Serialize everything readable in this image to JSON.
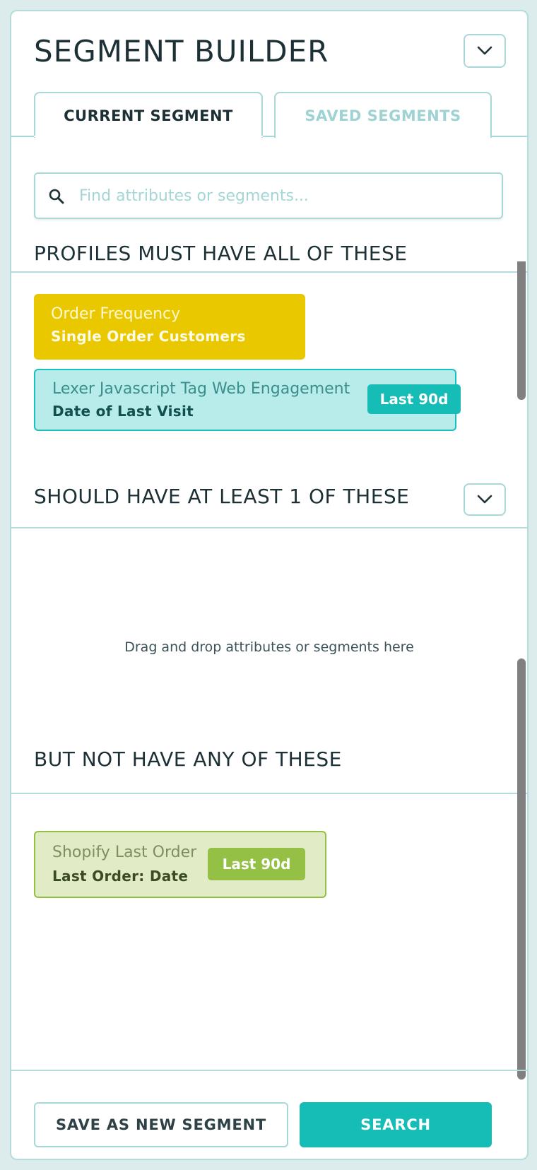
{
  "header": {
    "title": "SEGMENT BUILDER"
  },
  "tabs": [
    {
      "label": "CURRENT SEGMENT",
      "active": true
    },
    {
      "label": "SAVED SEGMENTS",
      "active": false
    }
  ],
  "search": {
    "placeholder": "Find attributes or segments...",
    "value": ""
  },
  "sections": {
    "must": {
      "title": "PROFILES MUST HAVE ALL OF THESE",
      "items": [
        {
          "name": "Order Frequency",
          "attribute": "Single Order Customers",
          "color": "#e9c800"
        },
        {
          "name": "Lexer Javascript Tag Web Engagement",
          "attribute": "Date of Last Visit",
          "badge": "Last 90d",
          "color": "#b7ecea"
        }
      ]
    },
    "should": {
      "title": "SHOULD HAVE AT LEAST 1 OF THESE",
      "empty_text": "Drag and drop attributes or segments here"
    },
    "not": {
      "title": "BUT NOT HAVE ANY OF THESE",
      "items": [
        {
          "name": "Shopify Last Order",
          "attribute": "Last Order: Date",
          "badge": "Last 90d",
          "color": "#e1ecc7"
        }
      ]
    }
  },
  "footer": {
    "save_label": "SAVE AS NEW SEGMENT",
    "search_label": "SEARCH"
  },
  "colors": {
    "accent": "#16bcb6",
    "border": "#a9d8d8",
    "background": "#dcebeb"
  },
  "icons": [
    "chevron-down-icon",
    "search-icon"
  ]
}
